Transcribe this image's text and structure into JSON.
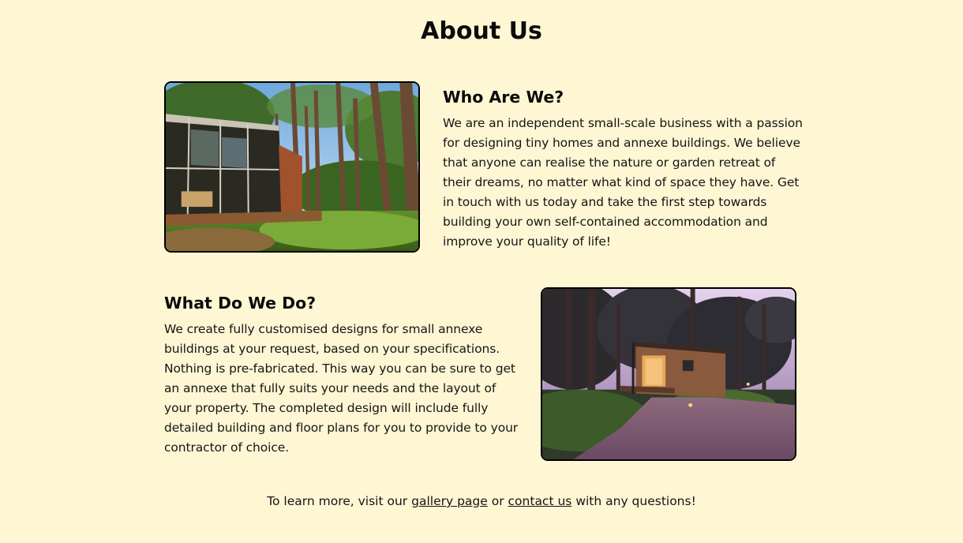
{
  "page": {
    "title": "About Us",
    "background": "#fff6d4"
  },
  "who": {
    "heading": "Who Are We?",
    "body": "We are an independent small-scale business with a passion for designing tiny homes and annexe buildings. We believe that anyone can realise the nature or garden retreat of their dreams, no matter what kind of space they have. Get in touch with us today and take the first step towards building your own self-contained accommodation and improve your quality of life!",
    "image_icon": "glass-cabin-forest-photo"
  },
  "what": {
    "heading": "What Do We Do?",
    "body": "We create fully customised designs for small annexe buildings at your request, based on your specifications. Nothing is pre-fabricated. This way you can be sure to get an annexe that fully suits your needs and the layout of your property. The completed design will include fully detailed building and floor plans for you to provide to your contractor of choice.",
    "image_icon": "wooden-cabin-dusk-photo"
  },
  "footer": {
    "prefix": "To learn more, visit our",
    "gallery_link": "gallery page",
    "middle": "or",
    "contact_link": "contact us",
    "suffix": "with any questions!"
  }
}
